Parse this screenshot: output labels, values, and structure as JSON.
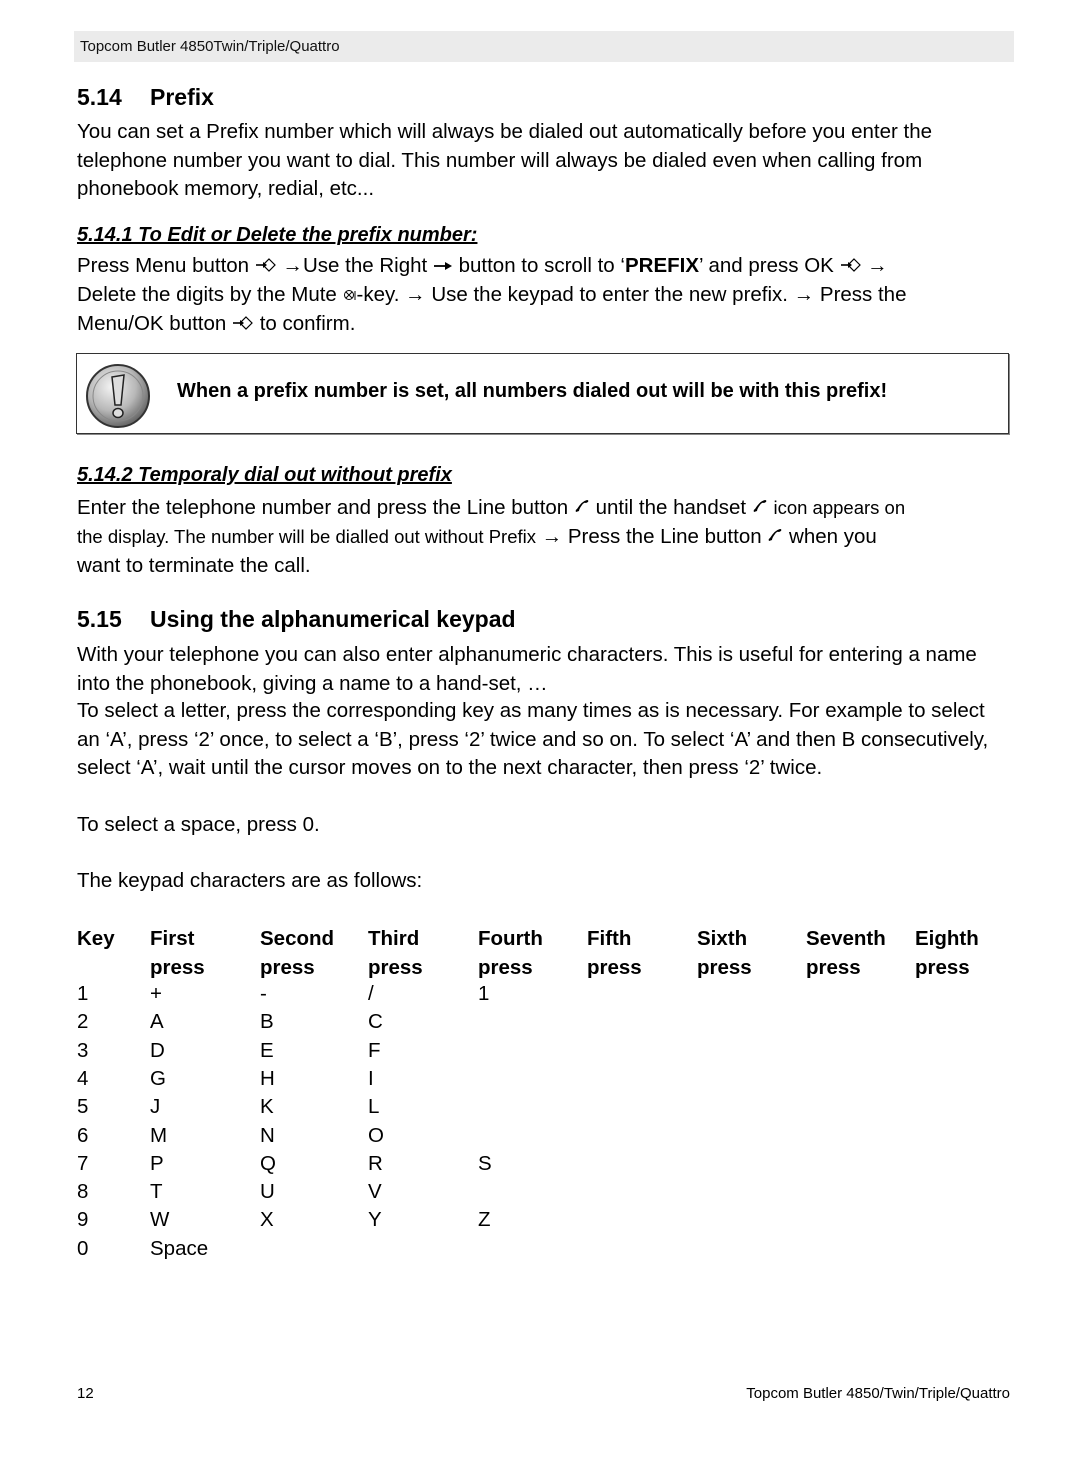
{
  "header": {
    "title": "Topcom Butler 4850Twin/Triple/Quattro"
  },
  "section_514": {
    "number": "5.14",
    "title": "Prefix",
    "intro": "You can set a Prefix number which will always be dialed out automatically before you enter the telephone number you want to dial. This number will always be dialed even when calling from phonebook memory, redial, etc...",
    "sub1": {
      "title": "5.14.1 To Edit or Delete the prefix number:",
      "line1_a": "Press Menu button",
      "line1_b": "→Use the Right",
      "line1_c": "button to scroll to ‘",
      "line1_bold": "PREFIX",
      "line1_d": "’ and press OK",
      "line1_e": "→",
      "line2_a": "Delete the digits by the Mute",
      "line2_b": "-key. → Use the keypad to enter the new prefix. → Press the",
      "line3_a": "Menu/OK button",
      "line3_b": "to confirm."
    },
    "note": "When a prefix number is set, all numbers dialed out will be with this prefix!",
    "sub2": {
      "title": "5.14.2 Temporaly dial out without prefix",
      "line1_a": "Enter the telephone number and press the Line button",
      "line1_b": "until the handset",
      "line1_c": "icon appears on",
      "line2_a": "the display.  The number will be dialled out without Prefix",
      "line2_b": "→ Press the Line button",
      "line2_c": "when you",
      "line3": "want to terminate the call."
    }
  },
  "section_515": {
    "number": "5.15",
    "title": "Using the alphanumerical keypad",
    "para1": "With your telephone you can also enter alphanumeric characters. This is useful for entering a name into the phonebook, giving a name to a hand-set, …",
    "para2": "To select a letter, press the corresponding key as many times as is necessary. For example to select an ‘A’, press ‘2’ once, to select a ‘B’, press ‘2’ twice and so on. To select ‘A’ and then B consecutively, select ‘A’, wait until the cursor moves on to the next character, then press ‘2’ twice.",
    "para3": "To select a space, press 0.",
    "para4": "The keypad characters are as follows:"
  },
  "keypad_table": {
    "headers": [
      [
        "Key",
        ""
      ],
      [
        "First",
        "press"
      ],
      [
        "Second",
        "press"
      ],
      [
        "Third",
        "press"
      ],
      [
        "Fourth",
        "press"
      ],
      [
        "Fifth",
        "press"
      ],
      [
        "Sixth",
        "press"
      ],
      [
        "Seventh",
        "press"
      ],
      [
        "Eighth",
        "press"
      ]
    ],
    "rows": [
      [
        "1",
        "+",
        "-",
        "/",
        "1"
      ],
      [
        "2",
        "A",
        "B",
        "C",
        ""
      ],
      [
        "3",
        "D",
        "E",
        "F",
        ""
      ],
      [
        "4",
        "G",
        "H",
        "I",
        ""
      ],
      [
        "5",
        "J",
        "K",
        "L",
        ""
      ],
      [
        "6",
        "M",
        "N",
        "O",
        ""
      ],
      [
        "7",
        "P",
        "Q",
        "R",
        "S"
      ],
      [
        "8",
        "T",
        "U",
        "V",
        ""
      ],
      [
        "9",
        "W",
        "X",
        "Y",
        "Z"
      ],
      [
        "0",
        "Space",
        "",
        "",
        ""
      ]
    ]
  },
  "footer": {
    "page_number": "12",
    "title": "Topcom Butler 4850/Twin/Triple/Quattro"
  },
  "icons": {
    "menu_ok": "menu-ok-icon",
    "right_arrow": "right-arrow-icon",
    "mute": "mute-icon",
    "line": "handset-icon",
    "warning": "exclamation-icon"
  }
}
